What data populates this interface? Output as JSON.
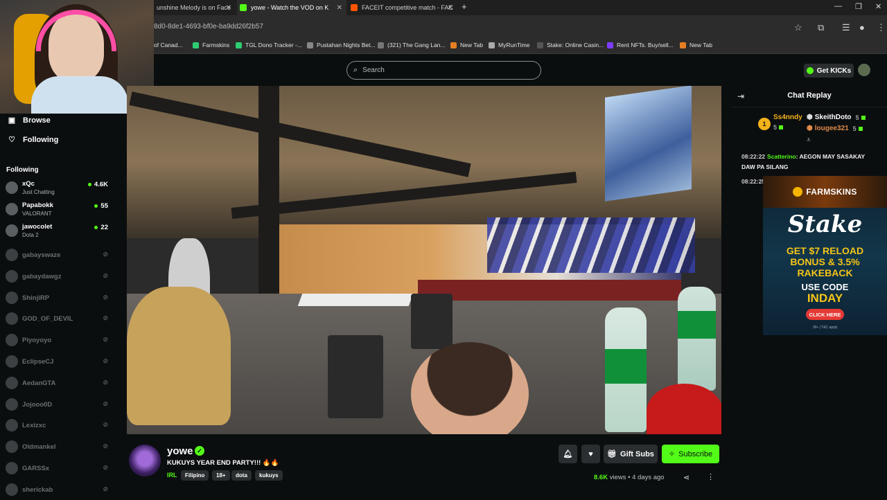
{
  "browser": {
    "tabs": [
      {
        "label": "unshine Melody is on Face",
        "active": false
      },
      {
        "label": "yowe - Watch the VOD on K",
        "active": true
      },
      {
        "label": "FACEIT competitive match - FAC",
        "active": false
      }
    ],
    "new_tab": "+",
    "url": "8d0-8de1-4693-bf0e-ba9dd26f2b57",
    "bookmarks": [
      {
        "label": "of Canad...",
        "color": "#c0392b"
      },
      {
        "label": "Farmskins",
        "color": "#2ecc71"
      },
      {
        "label": "TGL Dono Tracker -...",
        "color": "#2ecc71"
      },
      {
        "label": "Pustahan Nights Bet...",
        "color": "#888888"
      },
      {
        "label": "(321) The Gang Lan...",
        "color": "#777777"
      },
      {
        "label": "New Tab",
        "color": "#e67e22"
      },
      {
        "label": "MyRunTime",
        "color": "#aaaaaa"
      },
      {
        "label": "Stake: Online Casin...",
        "color": "#555555"
      },
      {
        "label": "Rent NFTs. Buy/sell...",
        "color": "#7d3cff"
      },
      {
        "label": "New Tab",
        "color": "#e67e22"
      }
    ]
  },
  "header": {
    "search_placeholder": "Search",
    "get_kicks": "Get KICKs"
  },
  "sidebar": {
    "nav": [
      {
        "label": "Browse",
        "icon": "browse-icon"
      },
      {
        "label": "Following",
        "icon": "heart-icon"
      }
    ],
    "following_heading": "Following",
    "channels_live": [
      {
        "name": "xQc",
        "game": "Just Chatting",
        "viewers": "4.6K"
      },
      {
        "name": "Papabokk",
        "game": "VALORANT",
        "viewers": "55"
      },
      {
        "name": "jawocolet",
        "game": "Dota 2",
        "viewers": "22"
      }
    ],
    "channels_offline": [
      "gabayswaze",
      "gabaydawgz",
      "ShinjiRP",
      "GOD_OF_DEVIL",
      "Piyoyoyo",
      "EclipseCJ",
      "AedanGTA",
      "Jojooo0D",
      "Lexizxc",
      "Oldmankel",
      "GARSSx",
      "sherickab"
    ]
  },
  "chat": {
    "title": "Chat Replay",
    "top_gifters": [
      {
        "name": "Ss4nndy",
        "count": "5",
        "rank": "1"
      },
      {
        "name": "SkeithDoto",
        "count": "5"
      },
      {
        "name": "lougee321",
        "count": "5"
      }
    ],
    "messages": [
      {
        "time": "08:22:22",
        "user": "Scatterino",
        "text": "AEGON MAY SASAKAY DAW PA SILANG"
      },
      {
        "time": "08:22:25",
        "user": "",
        "text": ""
      }
    ]
  },
  "ad": {
    "brand": "FARMSKINS",
    "logo": "Stake",
    "headline_1": "GET $7 RELOAD",
    "headline_2": "BONUS & 3.5%",
    "headline_3": "RAKEBACK",
    "code_label": "USE CODE",
    "code": "INDAY",
    "cta": "CLICK HERE",
    "fine_print": "18+ | T&C apply"
  },
  "stream": {
    "streamer": "yowe",
    "title": "KUKUYS YEAR END PARTY!!! 🔥🔥",
    "category": "IRL",
    "tags": [
      "Filipino",
      "18+",
      "dota",
      "kukuys"
    ],
    "gift_subs": "Gift Subs",
    "subscribe": "Subscribe",
    "views": "8.6K",
    "views_suffix": "views",
    "separator": "•",
    "age": "4 days ago"
  },
  "colors": {
    "accent": "#53fc18",
    "background": "#0b0e0f"
  }
}
